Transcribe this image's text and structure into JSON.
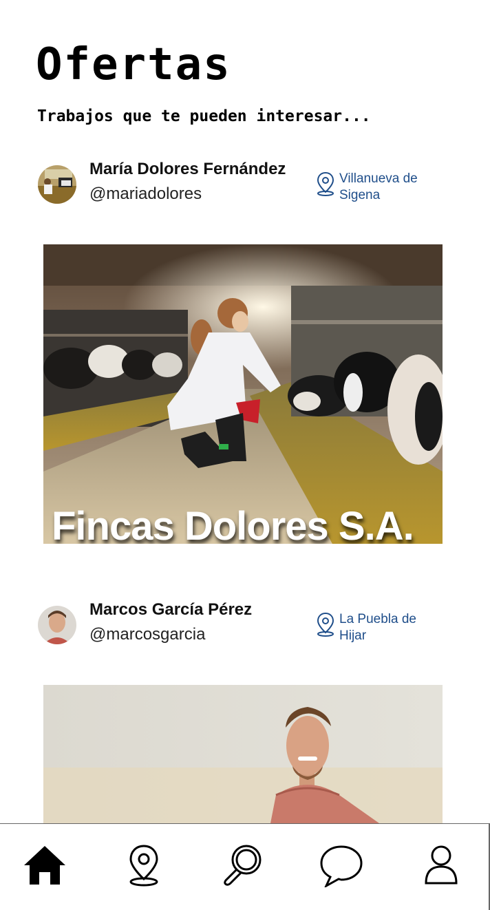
{
  "header": {
    "title": "Ofertas",
    "subtitle": "Trabajos que te pueden interesar..."
  },
  "posts": [
    {
      "user_name": "María Dolores Fernández",
      "user_handle": "@mariadolores",
      "location": "Villanueva de Sigena",
      "company": "Fincas Dolores S.A."
    },
    {
      "user_name": "Marcos García Pérez",
      "user_handle": "@marcosgarcia",
      "location": "La Puebla de Hijar"
    }
  ],
  "nav": [
    {
      "icon": "home-icon",
      "active": true
    },
    {
      "icon": "map-pin-icon"
    },
    {
      "icon": "search-icon"
    },
    {
      "icon": "chat-icon"
    },
    {
      "icon": "profile-icon"
    }
  ],
  "colors": {
    "location_text": "#1f4e8a",
    "title": "#000000",
    "nav_border": "#666666"
  }
}
